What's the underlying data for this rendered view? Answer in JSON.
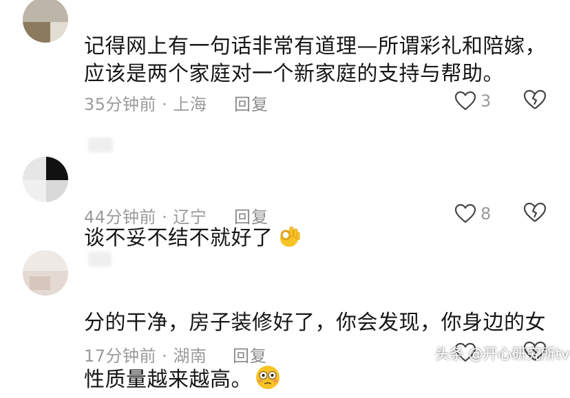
{
  "comments": [
    {
      "text": "记得网上有一句话非常有道理—所谓彩礼和陪嫁，\n应该是两个家庭对一个新家庭的支持与帮助。",
      "time": "35分钟前",
      "location": "上海",
      "reply_label": "回复",
      "like_count": "3"
    },
    {
      "text": "谈不妥不结不就好了",
      "emoji": "ok-hand-emoji",
      "time": "44分钟前",
      "location": "辽宁",
      "reply_label": "回复",
      "like_count": "8"
    },
    {
      "text": "分的干净，房子装修好了，你会发现，你身边的女\n性质量越来越高。",
      "emoji": "flushed-face-emoji",
      "time": "17分钟前",
      "location": "湖南",
      "reply_label": "回复",
      "like_count": ""
    }
  ],
  "meta_separator": " · ",
  "watermark": "头条 @开心研究所tv",
  "colors": {
    "meta_gray": "#9a9a9a",
    "icon_stroke": "#444444",
    "emoji_yellow": "#f7c326"
  }
}
